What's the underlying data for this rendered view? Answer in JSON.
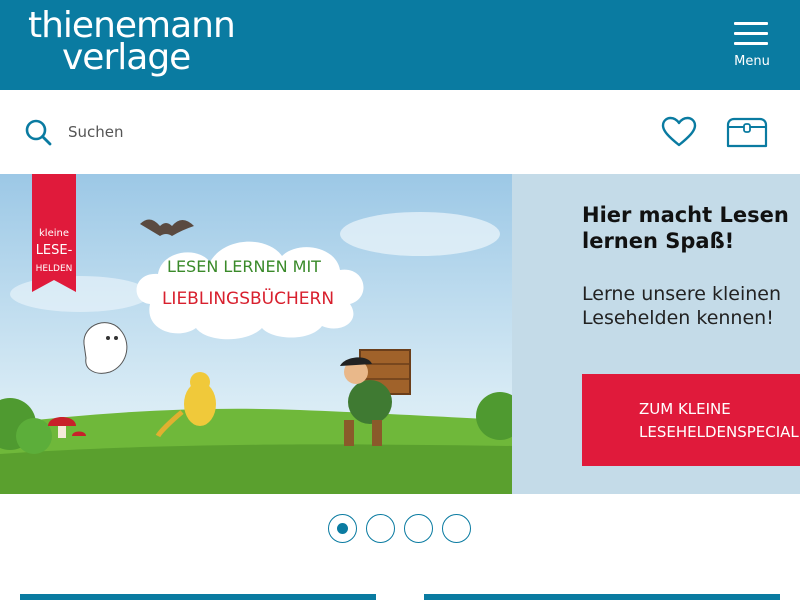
{
  "header": {
    "logo_line1": "thienemann",
    "logo_line2": "verlage",
    "menu_label": "Menu",
    "bg_color": "#0a7ba1"
  },
  "search": {
    "placeholder": "Suchen",
    "icon": "search-icon"
  },
  "actions": {
    "wishlist_icon": "heart-icon",
    "cart_icon": "cart-icon"
  },
  "hero": {
    "banner_ribbon": [
      "kleine",
      "LESE-",
      "HELDEN"
    ],
    "cloud_line1": "LESEN LERNEN MIT",
    "cloud_line2": "LIEBLINGSBÜCHERN",
    "title": "Hier macht Lesen lernen Spaß!",
    "subtitle": "Lerne unsere kleinen Lesehelden kennen!",
    "cta_label": "ZUM KLEINE\nLESEHELDENSPECIAL",
    "cta_color": "#e01a3b"
  },
  "carousel": {
    "count": 4,
    "active_index": 0
  }
}
